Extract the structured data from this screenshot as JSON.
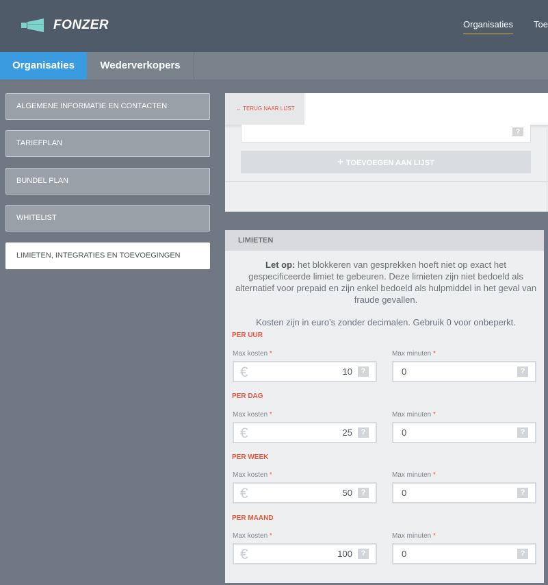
{
  "brand": {
    "name": "FONZER",
    "icon": "megaphone-icon"
  },
  "topnav": {
    "items": [
      {
        "label": "Organisaties"
      },
      {
        "label": "Toe"
      }
    ]
  },
  "tabs": [
    {
      "label": "Organisaties"
    },
    {
      "label": "Wederverkopers"
    }
  ],
  "sidebar": {
    "items": [
      {
        "label": "ALGEMENE INFORMATIE EN CONTACTEN"
      },
      {
        "label": "TARIEFPLAN"
      },
      {
        "label": "BUNDEL PLAN"
      },
      {
        "label": "WHITELIST"
      },
      {
        "label": "LIMIETEN, INTEGRATIES EN TOEVOEGINGEN"
      }
    ]
  },
  "toolbar": {
    "back_label": "← TERUG NAAR LIJST"
  },
  "list_panel": {
    "add_button_icon": "plus-icon",
    "add_button_label": "TOEVOEGEN AAN LIJST",
    "help": "?"
  },
  "limits": {
    "title": "LIMIETEN",
    "note_bold": "Let op:",
    "note_text": " het blokkeren van gesprekken hoeft niet op exact het gespecificeerde limiet te gebeuren. Deze limieten zijn niet bedoeld als alternatief voor prepaid en zijn enkel bedoeld als hulpmiddel in het geval van fraude gevallen.",
    "note2": "Kosten zijn in euro's zonder decimalen. Gebruik 0 voor onbeperkt.",
    "cost_label": "Max kosten",
    "minutes_label": "Max minuten",
    "required_mark": "*",
    "currency_symbol": "€",
    "help": "?",
    "sections": [
      {
        "title": "PER UUR",
        "max_cost": "10",
        "max_minutes": "0"
      },
      {
        "title": "PER DAG",
        "max_cost": "25",
        "max_minutes": "0"
      },
      {
        "title": "PER WEEK",
        "max_cost": "50",
        "max_minutes": "0"
      },
      {
        "title": "PER MAAND",
        "max_cost": "100",
        "max_minutes": "0"
      }
    ]
  },
  "colors": {
    "accent": "#3a9be0",
    "required": "#e8553d",
    "header": "#4f5b68",
    "active_underline": "#e5b54a"
  }
}
